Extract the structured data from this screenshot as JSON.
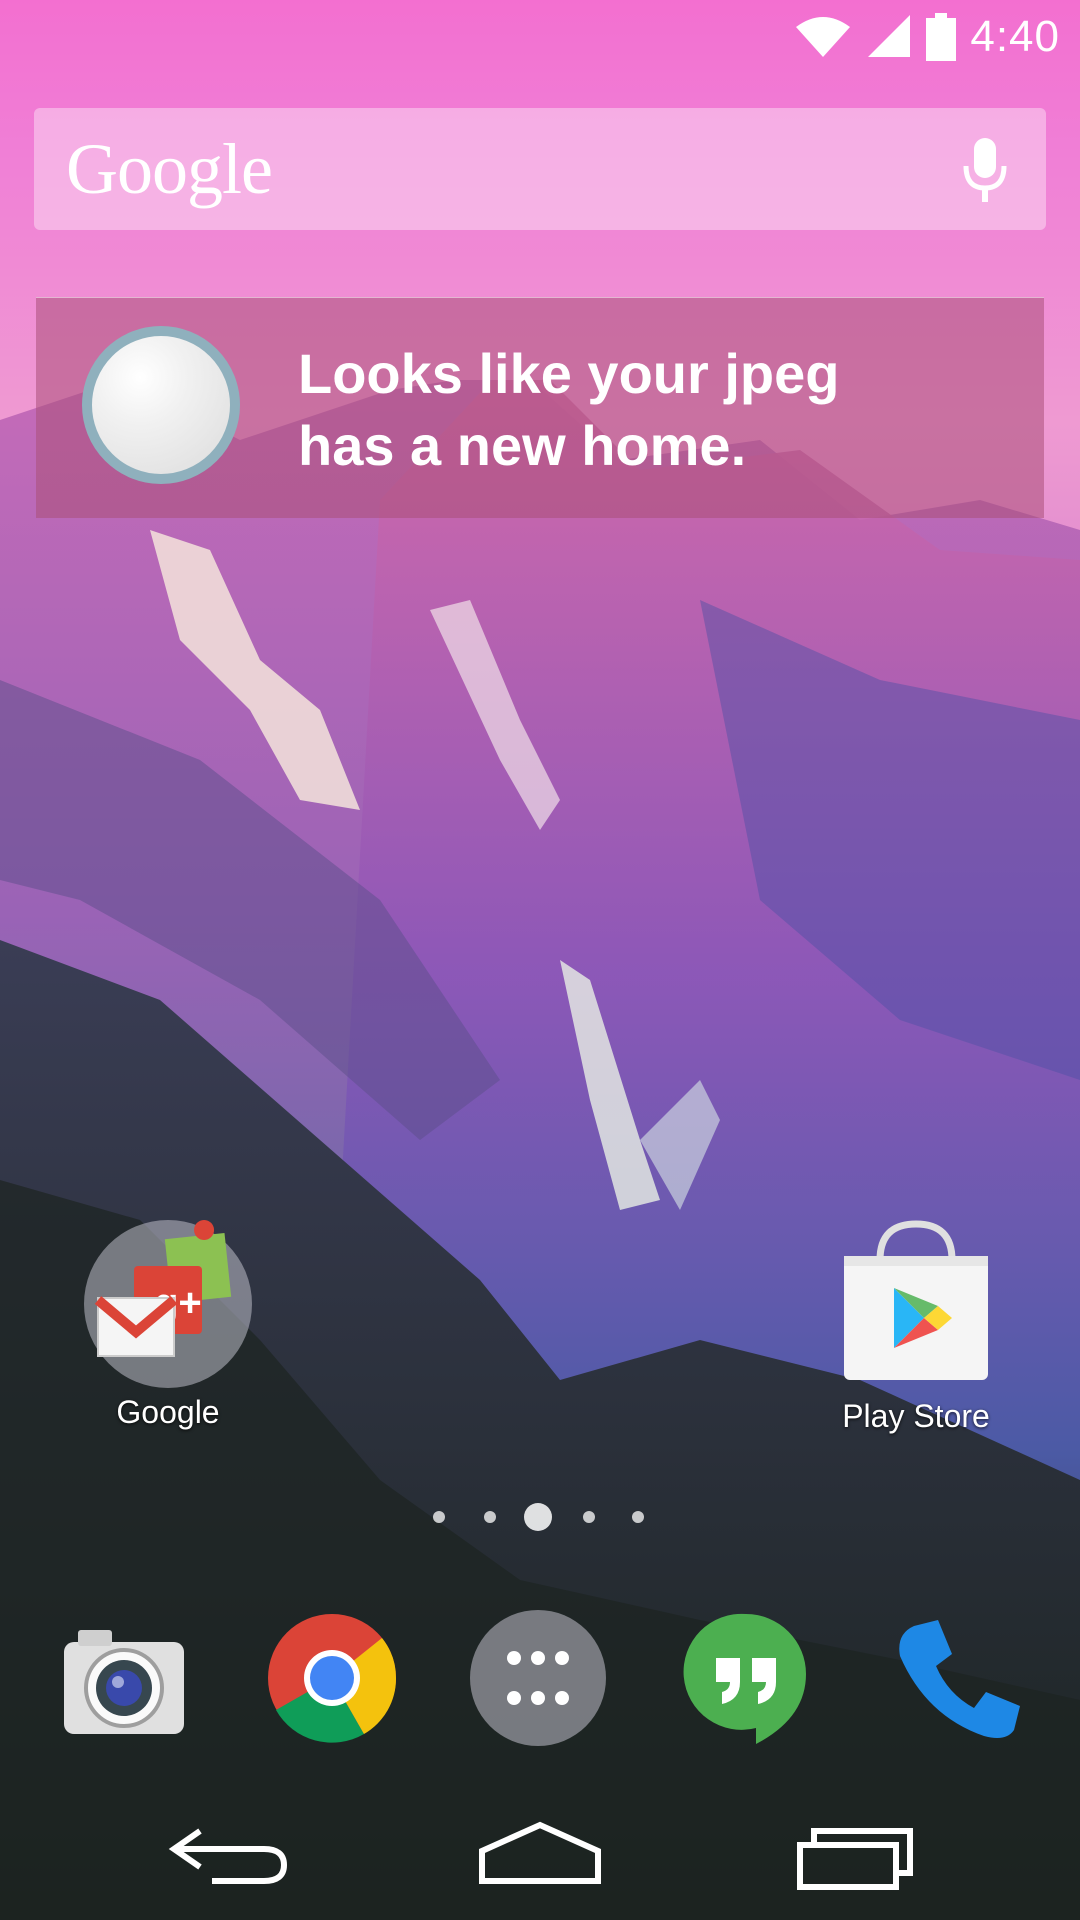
{
  "status_bar": {
    "time": "4:40",
    "icons": [
      "wifi-icon",
      "signal-icon",
      "battery-icon"
    ]
  },
  "search_bar": {
    "logo_text": "Google",
    "mic_icon": "mic-icon"
  },
  "banner": {
    "line1": "Looks like your jpeg",
    "line2": "has a new home."
  },
  "home": {
    "apps": [
      {
        "label": "Google",
        "icon": "google-folder-icon"
      },
      {
        "label": "Play Store",
        "icon": "play-store-icon"
      }
    ],
    "page_indicator": {
      "pages": 5,
      "current": 3
    }
  },
  "dock": {
    "items": [
      "camera-icon",
      "chrome-icon",
      "app-drawer-icon",
      "hangouts-icon",
      "phone-icon"
    ]
  },
  "nav_bar": {
    "buttons": [
      "back-icon",
      "home-icon",
      "recents-icon"
    ]
  },
  "colors": {
    "banner_bg": "#aa5078",
    "banner_ring": "#8fb0bd",
    "chrome_red": "#db4437",
    "chrome_yellow": "#f4c20d",
    "chrome_green": "#0f9d58",
    "chrome_blue": "#4285f4",
    "hangouts_green": "#4caf50",
    "phone_blue": "#1e88e5"
  }
}
